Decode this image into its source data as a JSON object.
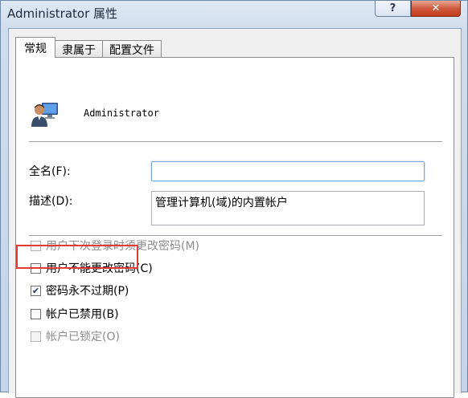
{
  "window": {
    "title": "Administrator 属性",
    "help_label": "?",
    "close_label": "✕"
  },
  "tabs": [
    {
      "label": "常规",
      "active": true
    },
    {
      "label": "隶属于",
      "active": false
    },
    {
      "label": "配置文件",
      "active": false
    }
  ],
  "user": {
    "icon": "user-account-icon",
    "name": "Administrator"
  },
  "fields": {
    "fullname_label": "全名(F):",
    "fullname_value": "",
    "description_label": "描述(D):",
    "description_value": "管理计算机(域)的内置帐户"
  },
  "checkboxes": [
    {
      "label": "用户下次登录时须更改密码(M)",
      "checked": false,
      "enabled": false
    },
    {
      "label": "用户不能更改密码(C)",
      "checked": false,
      "enabled": true
    },
    {
      "label": "密码永不过期(P)",
      "checked": true,
      "enabled": true
    },
    {
      "label": "帐户已禁用(B)",
      "checked": false,
      "enabled": true,
      "highlighted": true
    },
    {
      "label": "帐户已锁定(O)",
      "checked": false,
      "enabled": false
    }
  ],
  "colors": {
    "highlight": "#e23a36",
    "focus_border": "#7aa7d6"
  }
}
